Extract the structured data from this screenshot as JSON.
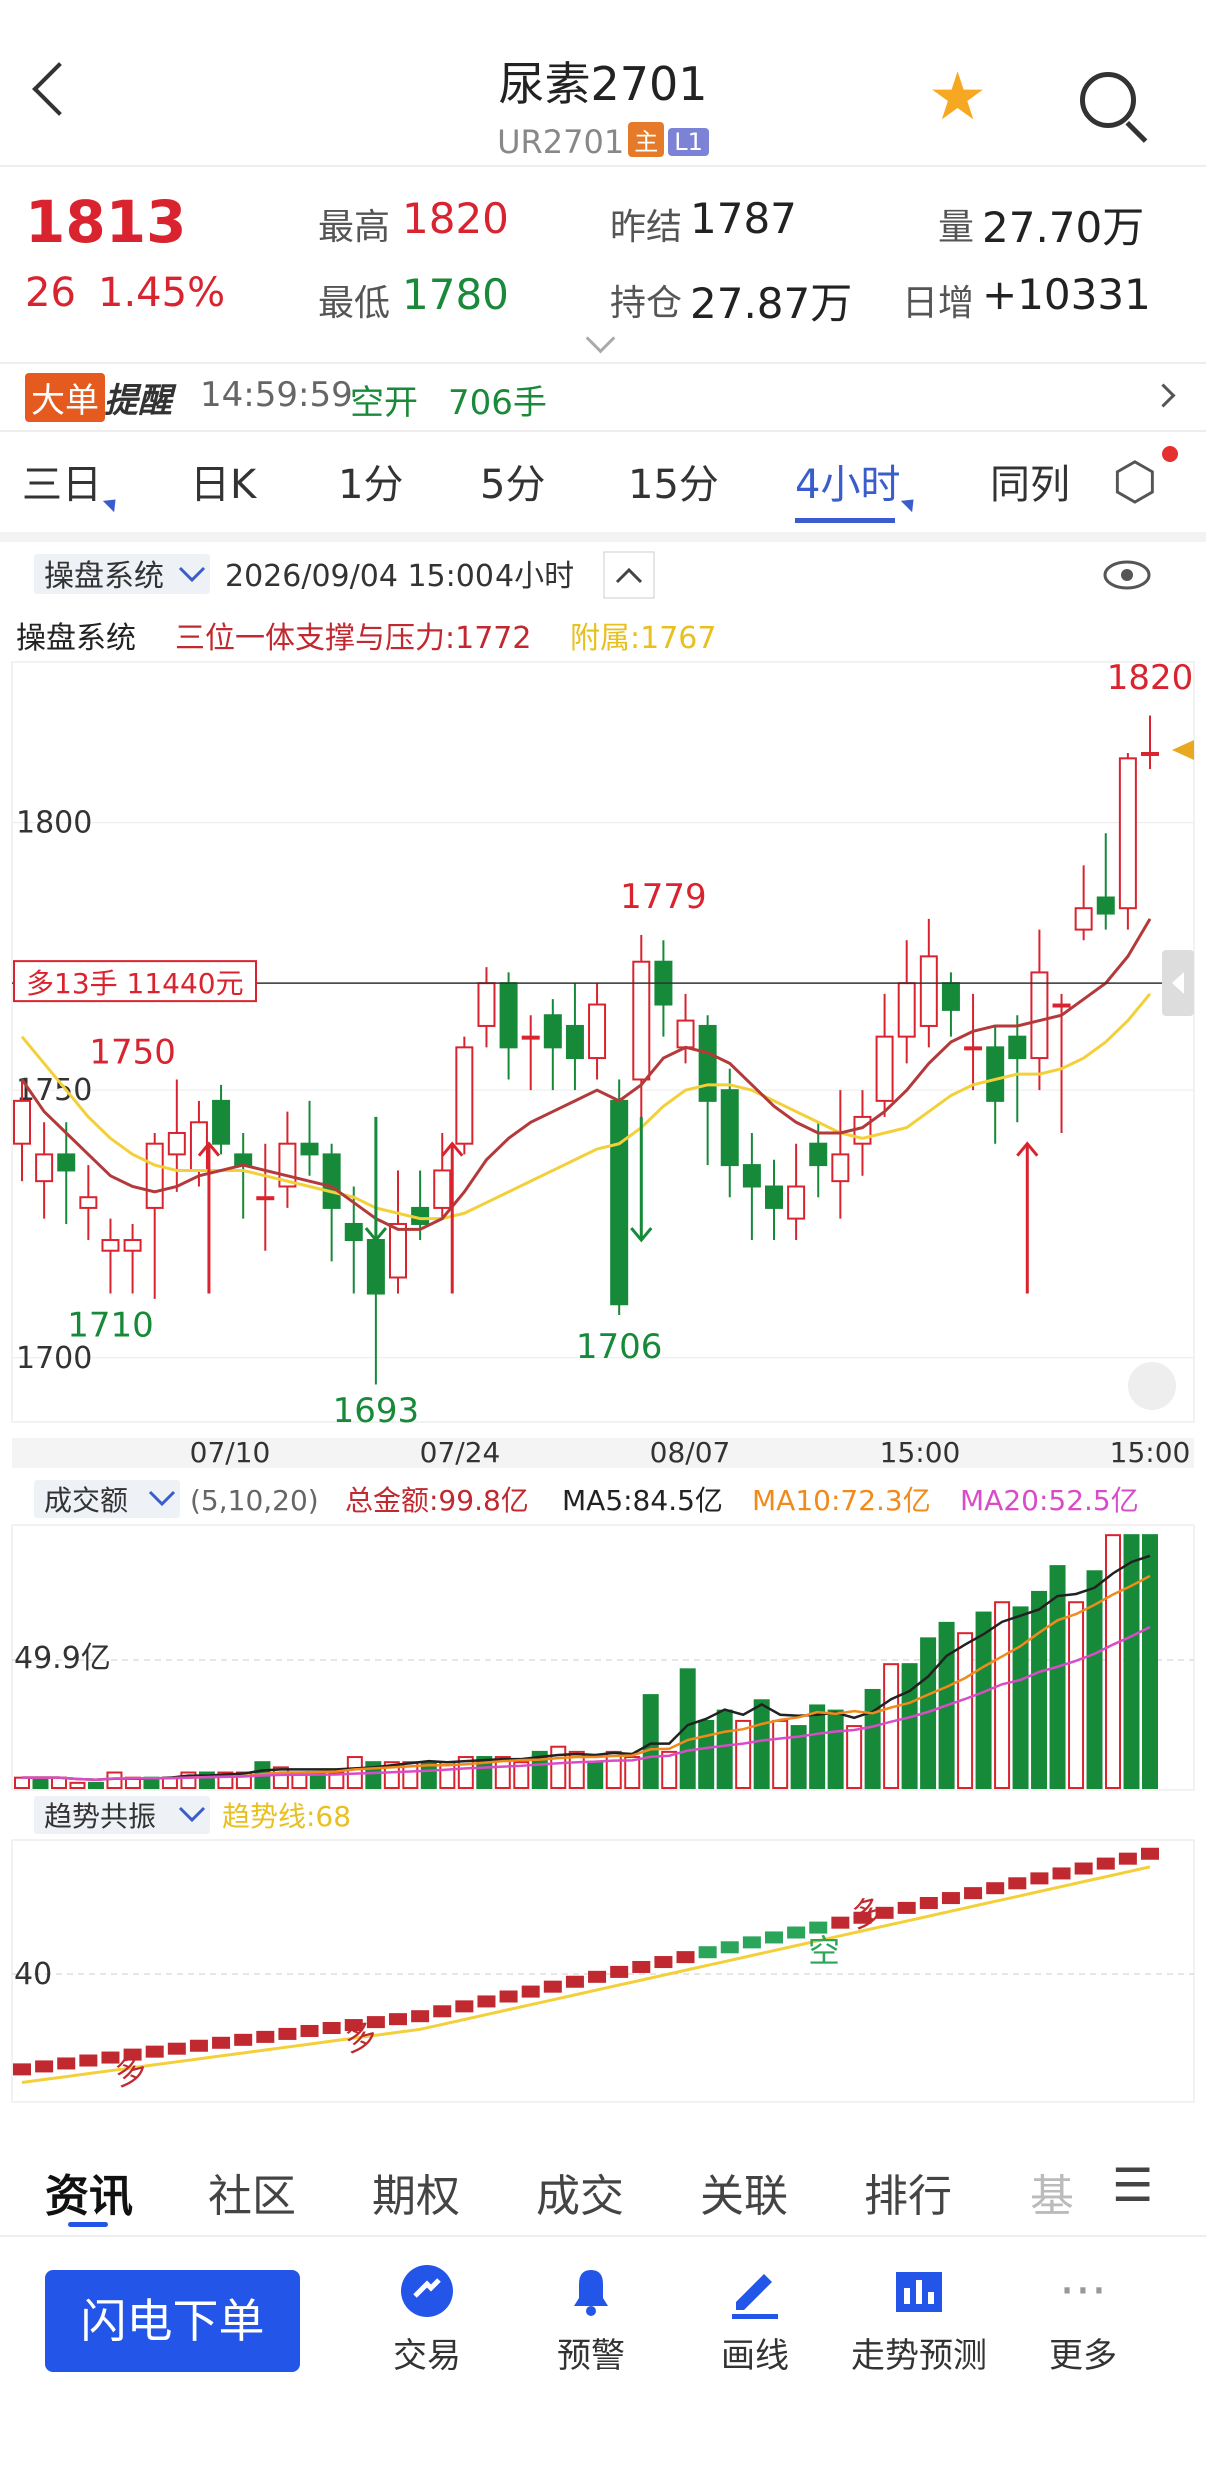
{
  "header": {
    "title": "尿素2701",
    "code": "UR2701",
    "badge_main": "主",
    "badge_level": "L1"
  },
  "quote": {
    "price": "1813",
    "change": "26",
    "change_pct": "1.45%",
    "high_label": "最高",
    "high": "1820",
    "low_label": "最低",
    "low": "1780",
    "prev_settle_label": "昨结",
    "prev_settle": "1787",
    "oi_label": "持仓",
    "oi": "27.87万",
    "volume_label": "量",
    "volume": "27.70万",
    "daily_inc_label": "日增",
    "daily_inc": "+10331"
  },
  "alert": {
    "tag_a": "大单",
    "tag_b": "提醒",
    "time": "14:59:59",
    "action": "空开",
    "amount": "706手"
  },
  "period_tabs": [
    "三日",
    "日K",
    "1分",
    "5分",
    "15分",
    "4小时",
    "同列"
  ],
  "active_period": "4小时",
  "chart_toolbar": {
    "system": "操盘系统",
    "datetime": "2026/09/04 15:00",
    "period": "4小时"
  },
  "main_indicator": {
    "name": "操盘系统",
    "line1": "三位一体支撑与压力:1772",
    "line2": "附属:1767",
    "position_label": "多13手 11440元"
  },
  "chart_data": {
    "type": "candlestick",
    "y_ticks": [
      "1800",
      "1750",
      "1700"
    ],
    "ylim": [
      1688,
      1830
    ],
    "x_ticks": [
      "07/10",
      "07/24",
      "08/07",
      "15:00",
      "15:00"
    ],
    "annotations": [
      "1820",
      "1779",
      "1750",
      "1710",
      "1706",
      "1693"
    ],
    "position_price": 1770,
    "candles": [
      [
        1740,
        1748,
        1733,
        1752
      ],
      [
        1733,
        1738,
        1726,
        1744
      ],
      [
        1738,
        1735,
        1725,
        1744
      ],
      [
        1728,
        1730,
        1722,
        1736
      ],
      [
        1720,
        1722,
        1712,
        1726
      ],
      [
        1720,
        1722,
        1712,
        1725
      ],
      [
        1728,
        1740,
        1711,
        1742
      ],
      [
        1738,
        1742,
        1731,
        1752
      ],
      [
        1735,
        1744,
        1732,
        1748
      ],
      [
        1748,
        1740,
        1738,
        1751
      ],
      [
        1738,
        1736,
        1726,
        1742
      ],
      [
        1730,
        1730,
        1720,
        1740
      ],
      [
        1732,
        1740,
        1728,
        1746
      ],
      [
        1740,
        1738,
        1734,
        1748
      ],
      [
        1738,
        1728,
        1718,
        1740
      ],
      [
        1725,
        1722,
        1712,
        1732
      ],
      [
        1722,
        1712,
        1695,
        1724
      ],
      [
        1715,
        1725,
        1712,
        1735
      ],
      [
        1728,
        1725,
        1722,
        1735
      ],
      [
        1728,
        1735,
        1726,
        1742
      ],
      [
        1740,
        1758,
        1738,
        1760
      ],
      [
        1762,
        1770,
        1758,
        1773
      ],
      [
        1770,
        1758,
        1752,
        1772
      ],
      [
        1760,
        1760,
        1750,
        1764
      ],
      [
        1764,
        1758,
        1750,
        1767
      ],
      [
        1762,
        1756,
        1750,
        1770
      ],
      [
        1756,
        1766,
        1752,
        1770
      ],
      [
        1748,
        1710,
        1708,
        1752
      ],
      [
        1752,
        1774,
        1738,
        1779
      ],
      [
        1774,
        1766,
        1760,
        1778
      ],
      [
        1758,
        1763,
        1755,
        1768
      ],
      [
        1762,
        1748,
        1736,
        1764
      ],
      [
        1750,
        1736,
        1730,
        1754
      ],
      [
        1736,
        1732,
        1722,
        1742
      ],
      [
        1732,
        1728,
        1722,
        1737
      ],
      [
        1726,
        1732,
        1722,
        1740
      ],
      [
        1740,
        1736,
        1730,
        1744
      ],
      [
        1733,
        1738,
        1726,
        1750
      ],
      [
        1740,
        1745,
        1734,
        1750
      ],
      [
        1748,
        1760,
        1745,
        1768
      ],
      [
        1760,
        1770,
        1755,
        1778
      ],
      [
        1762,
        1775,
        1758,
        1782
      ],
      [
        1770,
        1765,
        1760,
        1772
      ],
      [
        1758,
        1758,
        1750,
        1768
      ],
      [
        1758,
        1748,
        1740,
        1762
      ],
      [
        1760,
        1756,
        1744,
        1764
      ],
      [
        1756,
        1772,
        1750,
        1780
      ],
      [
        1766,
        1766,
        1742,
        1768
      ],
      [
        1780,
        1784,
        1778,
        1792
      ],
      [
        1786,
        1783,
        1780,
        1798
      ],
      [
        1784,
        1812,
        1780,
        1813
      ],
      [
        1813,
        1813,
        1810,
        1820
      ]
    ],
    "ma_red": [
      1752,
      1746,
      1742,
      1738,
      1734,
      1732,
      1731,
      1732,
      1734,
      1735,
      1736,
      1735,
      1734,
      1733,
      1732,
      1729,
      1726,
      1724,
      1724,
      1726,
      1731,
      1737,
      1741,
      1744,
      1746,
      1748,
      1750,
      1748,
      1751,
      1756,
      1758,
      1757,
      1755,
      1751,
      1747,
      1744,
      1742,
      1742,
      1743,
      1746,
      1750,
      1755,
      1759,
      1761,
      1762,
      1762,
      1763,
      1764,
      1767,
      1770,
      1775,
      1782
    ],
    "ma_yellow": [
      1760,
      1755,
      1750,
      1745,
      1741,
      1738,
      1736,
      1735,
      1735,
      1735,
      1735,
      1734,
      1733,
      1732,
      1731,
      1730,
      1728,
      1727,
      1726,
      1726,
      1727,
      1729,
      1731,
      1733,
      1735,
      1737,
      1739,
      1740,
      1743,
      1747,
      1750,
      1751,
      1751,
      1750,
      1748,
      1746,
      1744,
      1742,
      1741,
      1742,
      1743,
      1746,
      1749,
      1751,
      1752,
      1753,
      1753,
      1754,
      1756,
      1759,
      1763,
      1768
    ]
  },
  "volume_indicator": {
    "name": "成交额",
    "params": "(5,10,20)",
    "total": "总金额:99.8亿",
    "ma5": "MA5:84.5亿",
    "ma10": "MA10:72.3亿",
    "ma20": "MA20:52.5亿",
    "y_tick": "49.9亿",
    "bars": [
      2,
      2,
      2,
      1,
      1,
      3,
      2,
      2,
      2,
      3,
      3,
      3,
      3,
      5,
      4,
      3,
      3,
      3,
      6,
      5,
      5,
      5,
      5,
      5,
      6,
      6,
      6,
      5,
      7,
      8,
      7,
      5,
      7,
      6,
      18,
      7,
      23,
      13,
      15,
      13,
      17,
      13,
      12,
      16,
      15,
      12,
      19,
      24,
      24,
      29,
      32,
      30,
      34,
      36,
      35,
      38,
      43,
      36,
      42,
      49,
      49,
      49
    ]
  },
  "trend_indicator": {
    "name": "趋势共振",
    "line": "趋势线:68",
    "y_tick": "40",
    "labels": [
      "多",
      "多",
      "空",
      "多"
    ]
  },
  "bottom_tabs": [
    "资讯",
    "社区",
    "期权",
    "成交",
    "关联",
    "排行",
    "基"
  ],
  "active_bottom_tab": "资讯",
  "toolbar": {
    "flash_order": "闪电下单",
    "items": [
      "交易",
      "预警",
      "画线",
      "走势预测",
      "更多"
    ]
  },
  "colors": {
    "up": "#d9242f",
    "down": "#178a3a",
    "accent": "#2356e8",
    "ma_yellow": "#f3d03a"
  }
}
